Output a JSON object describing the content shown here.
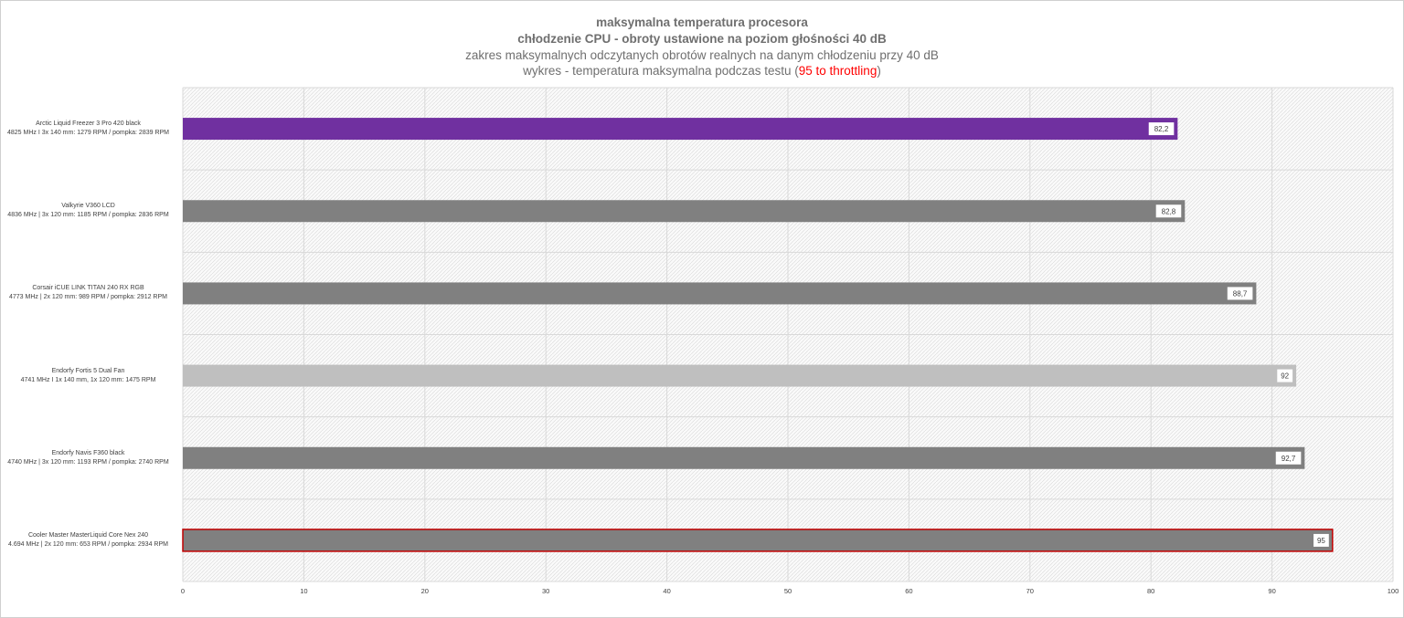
{
  "chart_data": {
    "type": "bar",
    "orientation": "horizontal",
    "title": {
      "line1": "maksymalna temperatura procesora",
      "line2": "chłodzenie CPU - obroty ustawione na poziom głośności 40 dB",
      "line3": "zakres maksymalnych odczytanych obrotów realnych na danym chłodzeniu przy 40 dB",
      "line4_pre": "wykres - temperatura maksymalna podczas testu (",
      "line4_highlight": "95 to throttling",
      "line4_post": ")"
    },
    "categories": [
      {
        "name": "Arctic Liquid Freezer 3 Pro 420 black",
        "detail": "4825 MHz I 3x 140 mm: 1279  RPM / pompka: 2839 RPM"
      },
      {
        "name": "Valkyrie V360 LCD",
        "detail": "4836 MHz  | 3x 120 mm: 1185 RPM / pompka: 2836 RPM"
      },
      {
        "name": "Corsair iCUE LINK TITAN 240 RX RGB",
        "detail": "4773 MHz  | 2x 120 mm: 989 RPM / pompka: 2912 RPM"
      },
      {
        "name": "Endorfy Fortis 5 Dual Fan",
        "detail": "4741 MHz I 1x 140 mm, 1x 120 mm: 1475 RPM"
      },
      {
        "name": "Endorfy Navis F360 black",
        "detail": "4740 MHz  | 3x 120 mm: 1193 RPM / pompka: 2740 RPM"
      },
      {
        "name": "Cooler Master MasterLiquid Core Nex 240",
        "detail": "4.694 MHz  | 2x 120 mm: 653 RPM / pompka: 2934 RPM"
      }
    ],
    "values": [
      82.2,
      82.8,
      88.7,
      92,
      92.7,
      95
    ],
    "value_labels": [
      "82,2",
      "82,8",
      "88,7",
      "92",
      "92,7",
      "95"
    ],
    "bar_colors": [
      "#7030a0",
      "#808080",
      "#808080",
      "#bfbfbf",
      "#808080",
      "#808080"
    ],
    "highlight_outline": [
      false,
      false,
      false,
      false,
      false,
      true
    ],
    "outline_color": "#c00000",
    "xlim": [
      0,
      100
    ],
    "xticks": [
      0,
      10,
      20,
      30,
      40,
      50,
      60,
      70,
      80,
      90,
      100
    ],
    "grid": true,
    "legend": "none"
  }
}
